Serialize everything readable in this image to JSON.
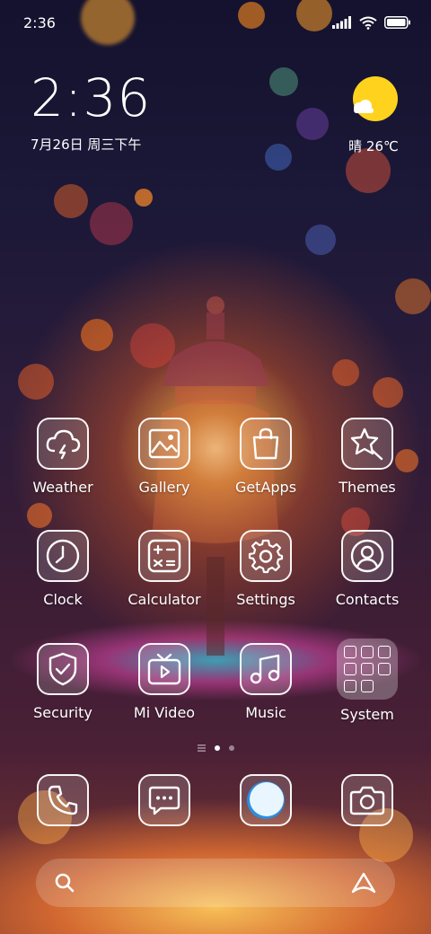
{
  "status_bar": {
    "time": "2:36"
  },
  "clock_widget": {
    "time": "2:36",
    "date": "7月26日 周三下午"
  },
  "weather_widget": {
    "condition": "晴",
    "temperature": "26℃"
  },
  "apps": [
    {
      "label": "Weather",
      "icon": "cloud-lightning-icon"
    },
    {
      "label": "Gallery",
      "icon": "image-icon"
    },
    {
      "label": "GetApps",
      "icon": "shopping-bag-icon"
    },
    {
      "label": "Themes",
      "icon": "star-brush-icon"
    },
    {
      "label": "Clock",
      "icon": "clock-icon"
    },
    {
      "label": "Calculator",
      "icon": "calculator-icon"
    },
    {
      "label": "Settings",
      "icon": "gear-icon"
    },
    {
      "label": "Contacts",
      "icon": "contact-icon"
    },
    {
      "label": "Security",
      "icon": "shield-check-icon"
    },
    {
      "label": "Mi Video",
      "icon": "tv-play-icon"
    },
    {
      "label": "Music",
      "icon": "music-note-icon"
    },
    {
      "label": "System",
      "icon": "folder-icon"
    }
  ],
  "dock": [
    {
      "icon": "phone-icon"
    },
    {
      "icon": "message-icon"
    },
    {
      "icon": "browser-icon"
    },
    {
      "icon": "camera-icon"
    }
  ],
  "page_indicator": {
    "count": 2,
    "active_index": 0
  },
  "search_bar": {
    "left_icon": "search-icon",
    "right_icon": "assistant-icon"
  },
  "colors": {
    "sun": "#FFD21E",
    "accent_white": "#FFFFFF"
  }
}
